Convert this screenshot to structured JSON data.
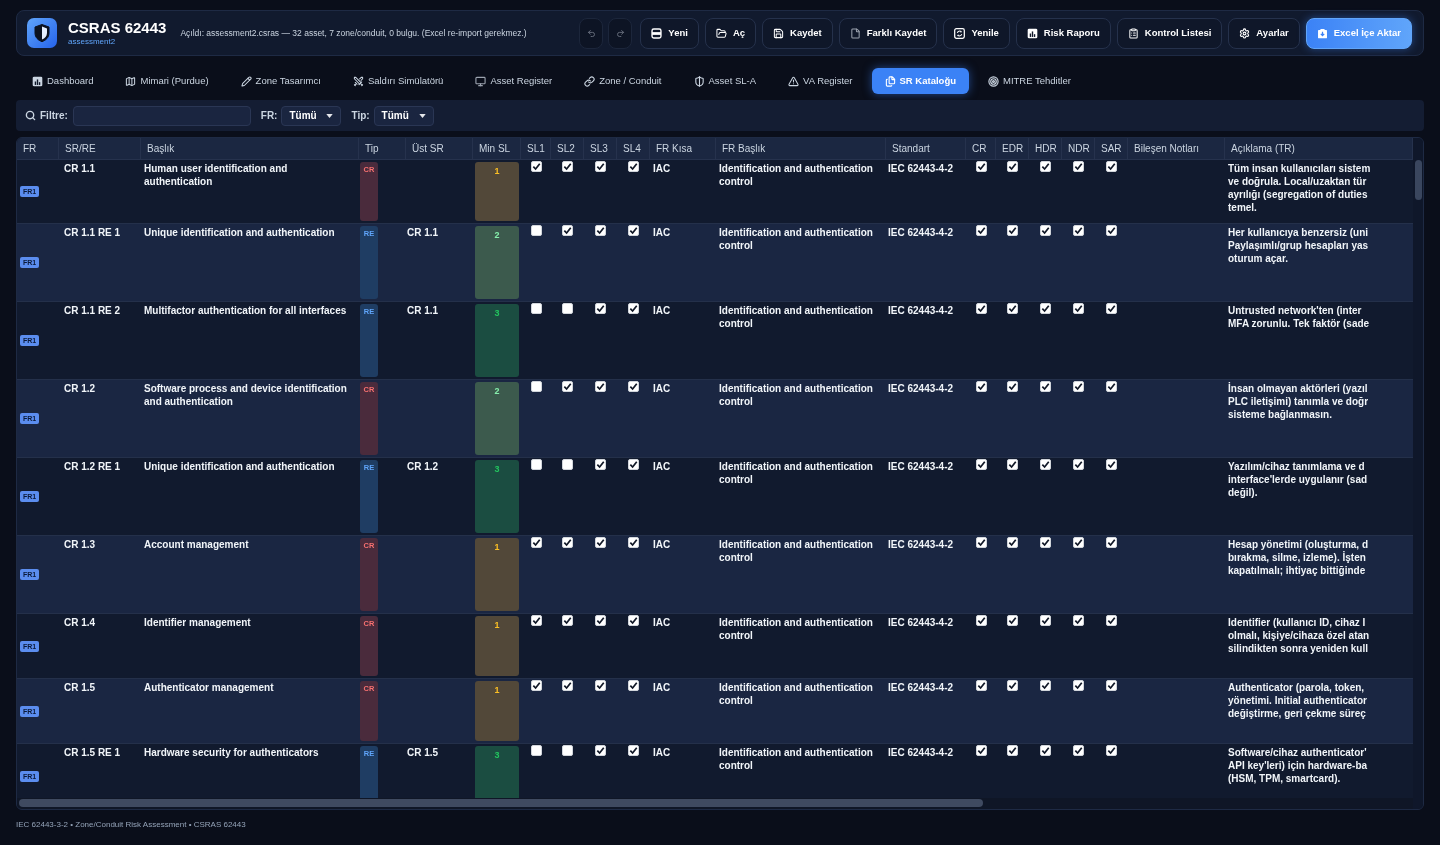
{
  "header": {
    "title": "CSRAS 62443",
    "subtitle": "assessment2",
    "message": "Açıldı: assessment2.csras — 32 asset, 7 zone/conduit, 0 bulgu. (Excel re-import gerekmez.)",
    "history": [
      {
        "kind": "undo",
        "disabled": true
      },
      {
        "kind": "redo",
        "disabled": true
      }
    ],
    "buttons": [
      {
        "label": "Yeni",
        "kind": "new",
        "primary": false
      },
      {
        "label": "Aç",
        "kind": "open",
        "primary": false
      },
      {
        "label": "Kaydet",
        "kind": "save",
        "primary": false
      },
      {
        "label": "Farklı Kaydet",
        "kind": "save_as",
        "primary": false
      },
      {
        "label": "Yenile",
        "kind": "refresh",
        "primary": false
      },
      {
        "label": "Risk Raporu",
        "kind": "report",
        "primary": false
      },
      {
        "label": "Kontrol Listesi",
        "kind": "checklist",
        "primary": false
      },
      {
        "label": "Ayarlar",
        "kind": "settings",
        "primary": false
      },
      {
        "label": "Excel İçe Aktar",
        "kind": "import",
        "primary": true
      }
    ]
  },
  "nav_tabs": [
    {
      "label": "Dashboard",
      "kind": "dashboard",
      "selected": false
    },
    {
      "label": "Mimari (Purdue)",
      "kind": "architecture",
      "selected": false
    },
    {
      "label": "Zone Tasarımcı",
      "kind": "zone_design",
      "selected": false
    },
    {
      "label": "Saldırı Simülatörü",
      "kind": "attack",
      "selected": false
    },
    {
      "label": "Asset Register",
      "kind": "asset_register",
      "selected": false
    },
    {
      "label": "Zone / Conduit",
      "kind": "zone_conduit",
      "selected": false
    },
    {
      "label": "Asset SL-A",
      "kind": "asset_sla",
      "selected": false
    },
    {
      "label": "VA Register",
      "kind": "va_register",
      "selected": false
    },
    {
      "label": "SR Kataloğu",
      "kind": "sr_catalog",
      "selected": true
    },
    {
      "label": "MITRE Tehditler",
      "kind": "mitre",
      "selected": false
    }
  ],
  "filter": {
    "label": "Filtre:",
    "selects": [
      {
        "label": "FR:",
        "value": "Tümü"
      },
      {
        "label": "Tip:",
        "value": "Tümü"
      }
    ]
  },
  "table": {
    "columns": [
      "FR",
      "SR/RE",
      "Başlık",
      "Tip",
      "Üst SR",
      "Min SL",
      "SL1",
      "SL2",
      "SL3",
      "SL4",
      "FR Kısa",
      "FR Başlık",
      "Standart",
      "CR",
      "EDR",
      "HDR",
      "NDR",
      "SAR",
      "Bileşen Notları",
      "Açıklama (TR)"
    ],
    "rows": [
      {
        "fr": "FR1",
        "sr": "CR 1.1",
        "title": "Human user identification and authentication",
        "tip": {
          "label": "CR",
          "kind": "cr"
        },
        "min_sl": {
          "label": "1",
          "kind": "low"
        },
        "sl": [
          {
            "checked": true
          },
          {
            "checked": true
          },
          {
            "checked": true
          },
          {
            "checked": true
          }
        ],
        "fr_short": "IAC",
        "fr_title": "Identification and authentication control",
        "standard": "IEC 62443-4-2",
        "components": [
          {
            "checked": true
          },
          {
            "checked": true
          },
          {
            "checked": true
          },
          {
            "checked": true
          },
          {
            "checked": true
          }
        ],
        "description": [
          "Tüm insan kullanıcıları sistem",
          "ve doğrula. Local/uzaktan tür",
          "ayrılığı (segregation of duties",
          "temel."
        ]
      },
      {
        "fr": "FR1",
        "sr": "CR 1.1 RE 1",
        "title": "Unique identification and authentication",
        "tip": {
          "label": "RE",
          "kind": "re"
        },
        "parent": "CR 1.1",
        "min_sl": {
          "label": "2",
          "kind": "medium"
        },
        "sl": [
          {
            "checked": false
          },
          {
            "checked": true
          },
          {
            "checked": true
          },
          {
            "checked": true
          }
        ],
        "fr_short": "IAC",
        "fr_title": "Identification and authentication control",
        "standard": "IEC 62443-4-2",
        "components": [
          {
            "checked": true
          },
          {
            "checked": true
          },
          {
            "checked": true
          },
          {
            "checked": true
          },
          {
            "checked": true
          }
        ],
        "description": [
          "Her kullanıcıya benzersiz (uni",
          "Paylaşımlı/grup hesapları yas",
          "oturum açar."
        ]
      },
      {
        "fr": "FR1",
        "sr": "CR 1.1 RE 2",
        "title": "Multifactor authentication for all interfaces",
        "tip": {
          "label": "RE",
          "kind": "re"
        },
        "parent": "CR 1.1",
        "min_sl": {
          "label": "3",
          "kind": "high"
        },
        "sl": [
          {
            "checked": false
          },
          {
            "checked": false
          },
          {
            "checked": true
          },
          {
            "checked": true
          }
        ],
        "fr_short": "IAC",
        "fr_title": "Identification and authentication control",
        "standard": "IEC 62443-4-2",
        "components": [
          {
            "checked": true
          },
          {
            "checked": true
          },
          {
            "checked": true
          },
          {
            "checked": true
          },
          {
            "checked": true
          }
        ],
        "description": [
          "Untrusted network'ten (inter",
          "MFA zorunlu. Tek faktör (sade"
        ]
      },
      {
        "fr": "FR1",
        "sr": "CR 1.2",
        "title": "Software process and device identification and authentication",
        "tip": {
          "label": "CR",
          "kind": "cr"
        },
        "min_sl": {
          "label": "2",
          "kind": "medium"
        },
        "sl": [
          {
            "checked": false
          },
          {
            "checked": true
          },
          {
            "checked": true
          },
          {
            "checked": true
          }
        ],
        "fr_short": "IAC",
        "fr_title": "Identification and authentication control",
        "standard": "IEC 62443-4-2",
        "components": [
          {
            "checked": true
          },
          {
            "checked": true
          },
          {
            "checked": true
          },
          {
            "checked": true
          },
          {
            "checked": true
          }
        ],
        "description": [
          "İnsan olmayan aktörleri (yazıl",
          "PLC iletişimi) tanımla ve doğr",
          "sisteme bağlanmasın."
        ]
      },
      {
        "fr": "FR1",
        "sr": "CR 1.2 RE 1",
        "title": "Unique identification and authentication",
        "tip": {
          "label": "RE",
          "kind": "re"
        },
        "parent": "CR 1.2",
        "min_sl": {
          "label": "3",
          "kind": "high"
        },
        "sl": [
          {
            "checked": false
          },
          {
            "checked": false
          },
          {
            "checked": true
          },
          {
            "checked": true
          }
        ],
        "fr_short": "IAC",
        "fr_title": "Identification and authentication control",
        "standard": "IEC 62443-4-2",
        "components": [
          {
            "checked": true
          },
          {
            "checked": true
          },
          {
            "checked": true
          },
          {
            "checked": true
          },
          {
            "checked": true
          }
        ],
        "description": [
          "Yazılım/cihaz tanımlama ve d",
          "interface'lerde uygulanır (sad",
          "değil)."
        ]
      },
      {
        "fr": "FR1",
        "sr": "CR 1.3",
        "title": "Account management",
        "tip": {
          "label": "CR",
          "kind": "cr"
        },
        "min_sl": {
          "label": "1",
          "kind": "low"
        },
        "sl": [
          {
            "checked": true
          },
          {
            "checked": true
          },
          {
            "checked": true
          },
          {
            "checked": true
          }
        ],
        "fr_short": "IAC",
        "fr_title": "Identification and authentication control",
        "standard": "IEC 62443-4-2",
        "components": [
          {
            "checked": true
          },
          {
            "checked": true
          },
          {
            "checked": true
          },
          {
            "checked": true
          },
          {
            "checked": true
          }
        ],
        "description": [
          "Hesap yönetimi (oluşturma, d",
          "bırakma, silme, izleme). İşten",
          "kapatılmalı; ihtiyaç bittiğinde"
        ]
      },
      {
        "fr": "FR1",
        "sr": "CR 1.4",
        "title": "Identifier management",
        "tip": {
          "label": "CR",
          "kind": "cr"
        },
        "min_sl": {
          "label": "1",
          "kind": "low"
        },
        "sl": [
          {
            "checked": true
          },
          {
            "checked": true
          },
          {
            "checked": true
          },
          {
            "checked": true
          }
        ],
        "fr_short": "IAC",
        "fr_title": "Identification and authentication control",
        "standard": "IEC 62443-4-2",
        "components": [
          {
            "checked": true
          },
          {
            "checked": true
          },
          {
            "checked": true
          },
          {
            "checked": true
          },
          {
            "checked": true
          }
        ],
        "description": [
          "Identifier (kullanıcı ID, cihaz I",
          "olmalı, kişiye/cihaza özel atan",
          "silindikten sonra yeniden kull"
        ]
      },
      {
        "fr": "FR1",
        "sr": "CR 1.5",
        "title": "Authenticator management",
        "tip": {
          "label": "CR",
          "kind": "cr"
        },
        "min_sl": {
          "label": "1",
          "kind": "low"
        },
        "sl": [
          {
            "checked": true
          },
          {
            "checked": true
          },
          {
            "checked": true
          },
          {
            "checked": true
          }
        ],
        "fr_short": "IAC",
        "fr_title": "Identification and authentication control",
        "standard": "IEC 62443-4-2",
        "components": [
          {
            "checked": true
          },
          {
            "checked": true
          },
          {
            "checked": true
          },
          {
            "checked": true
          },
          {
            "checked": true
          }
        ],
        "description": [
          "Authenticator (parola, token,",
          "yönetimi. Initial authenticator",
          "değiştirme, geri çekme süreç"
        ]
      },
      {
        "fr": "FR1",
        "sr": "CR 1.5 RE 1",
        "title": "Hardware security for authenticators",
        "tip": {
          "label": "RE",
          "kind": "re"
        },
        "parent": "CR 1.5",
        "min_sl": {
          "label": "3",
          "kind": "high"
        },
        "sl": [
          {
            "checked": false
          },
          {
            "checked": false
          },
          {
            "checked": true
          },
          {
            "checked": true
          }
        ],
        "fr_short": "IAC",
        "fr_title": "Identification and authentication control",
        "standard": "IEC 62443-4-2",
        "components": [
          {
            "checked": true
          },
          {
            "checked": true
          },
          {
            "checked": true
          },
          {
            "checked": true
          },
          {
            "checked": true
          }
        ],
        "description": [
          "Software/cihaz authenticator'",
          "API key'leri) için hardware-ba",
          "(HSM, TPM, smartcard)."
        ]
      }
    ]
  },
  "footer": "IEC 62443-3-2 • Zone/Conduit Risk Assessment • CSRAS 62443"
}
